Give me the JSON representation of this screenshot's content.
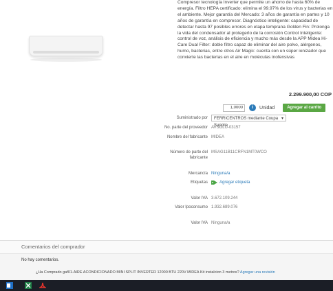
{
  "description": "Compresor tecnología Inverter que permite un ahorro de hasta 60% de energía. Filtro HEPA certificado: elimina el 99.97% de los virus y bacterias en el ambiente. Mejor garantía del Mercado: 3 años de garantía en partes y 10 años de garantía en compresor. Diagnóstico inteligente: capacidad de detectar hasta 97 posibles errores en etapa temprana Golden Fin: Prolonga la vida del condensador al protegerlo de la corrosión Control Inteligente: control de voz, análisis de eficiencia y mucho más desde la APP Midea Hi-Care Dual Filter: doble filtro capaz de eliminar del aire polvo, alérgenos, humo, bacterias, entre otros Air Magic: cuenta con un súper ionizador que convierte las bacterias en el aire en moléculas inofensivas",
  "price": "2.299.900,00 COP",
  "quantity": "1,0000",
  "unit_label": "Unidad",
  "add_to_cart": "Agregar al carrito",
  "fields": {
    "supplier_label": "Suministrado por",
    "supplier_value": "FERRICENTROS mediante Coupa Supplie",
    "part_no_label": "No. parte del proveedor",
    "part_no_value": "AVSOLU-03157",
    "manufacturer_label": "Nombre del fabricante",
    "manufacturer_value": "MIDEA",
    "mfr_part_label": "Número de parte del fabricante",
    "mfr_part_value": "MSAG11B11CRFN1MT0WCO",
    "commodity_label": "Mercancía",
    "commodity_value": "Ninguna/a",
    "tags_label": "Etiquetas",
    "tags_value": "Agregar etiqueta",
    "iva_label": "Valor IVA",
    "iva_value": "3.672.109.244",
    "ipoconsumo_label": "Valor Ipoconsumo",
    "ipoconsumo_value": "1.932.689.076",
    "iva2_label": "Valor IVA",
    "iva2_value": "Ninguna/a"
  },
  "comments": {
    "title": "Comentarios del comprador",
    "empty": "No hay comentarios.",
    "question": "¿Ha Comprado gaf01-AIRE ACONDICIONADO MINI SPLIT INVERTER 12000 BTU 220V MIDEA Kit instalcion 3 metros?",
    "review_link": "Agregar una revisión"
  }
}
